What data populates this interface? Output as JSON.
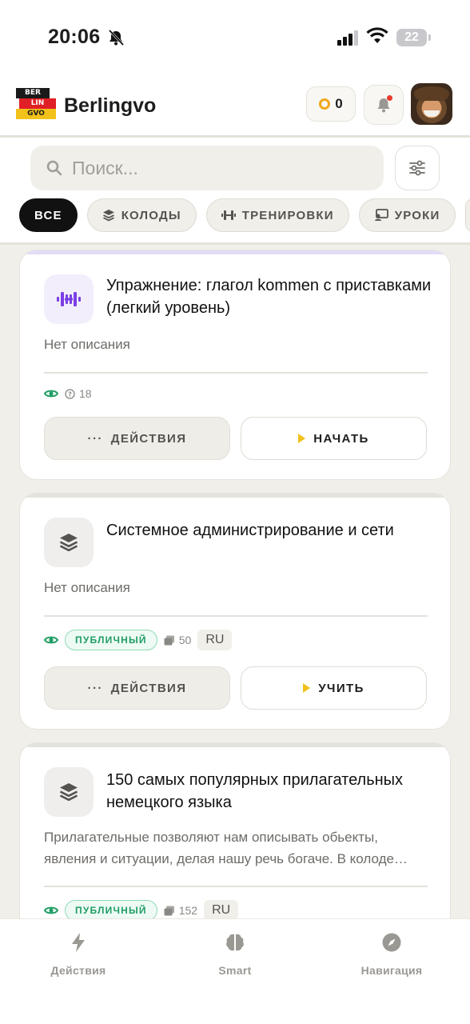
{
  "status_bar": {
    "time": "20:06",
    "battery": "22"
  },
  "header": {
    "logo_lines": [
      "BER",
      "LIN",
      "GVO"
    ],
    "brand": "Berlingvo",
    "coins": "0"
  },
  "search": {
    "placeholder": "Поиск..."
  },
  "filters": [
    {
      "label": "ВСЕ",
      "active": true
    },
    {
      "label": "КОЛОДЫ",
      "icon": "layers-icon"
    },
    {
      "label": "ТРЕНИРОВКИ",
      "icon": "dumbbell-icon"
    },
    {
      "label": "УРОКИ",
      "icon": "lesson-icon"
    }
  ],
  "cards": [
    {
      "title": "Упражнение: глагол kommen с приставками (легкий уровень)",
      "description": "Нет описания",
      "question_count": "18",
      "actions_label": "ДЕЙСТВИЯ",
      "primary_label": "НАЧАТЬ",
      "icon": "dumbbell-icon"
    },
    {
      "title": "Системное администрирование и сети",
      "description": "Нет описания",
      "badge": "ПУБЛИЧНЫЙ",
      "card_count": "50",
      "lang": "RU",
      "actions_label": "ДЕЙСТВИЯ",
      "primary_label": "УЧИТЬ",
      "icon": "layers-icon"
    },
    {
      "title": "150 самых популярных прилагательных немецкого языка",
      "description": "Прилагательные позволяют нам описывать обьекты, явления и ситуации, делая нашу речь богаче. В колоде…",
      "badge": "ПУБЛИЧНЫЙ",
      "card_count": "152",
      "lang": "RU",
      "icon": "layers-icon"
    }
  ],
  "bottom_nav": [
    {
      "label": "Действия",
      "icon": "lightning-icon"
    },
    {
      "label": "Smart",
      "icon": "brain-icon"
    },
    {
      "label": "Навигация",
      "icon": "compass-icon"
    }
  ],
  "colors": {
    "accent_yellow": "#f2c21b",
    "public_green": "#1f9d64",
    "purple": "#7b3fe4"
  }
}
